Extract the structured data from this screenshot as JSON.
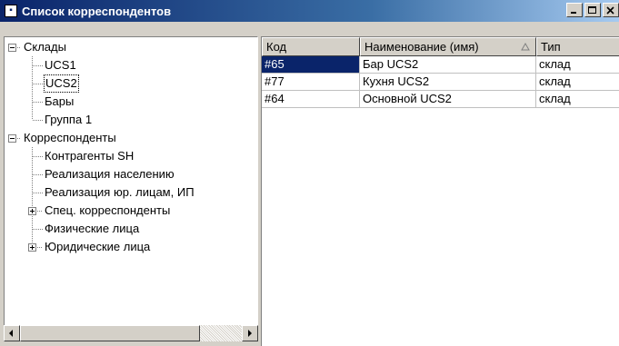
{
  "window": {
    "title": "Список корреспондентов",
    "icon": "document-icon"
  },
  "title_buttons": [
    "minimize-icon",
    "maximize-icon",
    "close-icon"
  ],
  "tree": {
    "nodes": [
      {
        "label": "Склады",
        "expanded": true
      },
      {
        "label": "UCS1"
      },
      {
        "label": "UCS2",
        "selected": true
      },
      {
        "label": "Бары"
      },
      {
        "label": "Группа 1"
      },
      {
        "label": "Корреспонденты",
        "expanded": true
      },
      {
        "label": "Контрагенты SH"
      },
      {
        "label": "Реализация населению"
      },
      {
        "label": "Реализация юр. лицам, ИП"
      },
      {
        "label": "Спец. корреспонденты",
        "expanded": false
      },
      {
        "label": "Физические лица"
      },
      {
        "label": "Юридические лица",
        "expanded": false
      }
    ]
  },
  "grid": {
    "columns": [
      "Код",
      "Наименование (имя)",
      "Тип"
    ],
    "sort_column": 1,
    "rows": [
      {
        "code": "#65",
        "name": "Бар UCS2",
        "type": "склад",
        "selected": true
      },
      {
        "code": "#77",
        "name": "Кухня UCS2",
        "type": "склад"
      },
      {
        "code": "#64",
        "name": "Основной UCS2",
        "type": "склад"
      }
    ]
  },
  "colors": {
    "title_active": "#0a246a",
    "selection": "#0a246a",
    "face": "#d4d0c8"
  }
}
